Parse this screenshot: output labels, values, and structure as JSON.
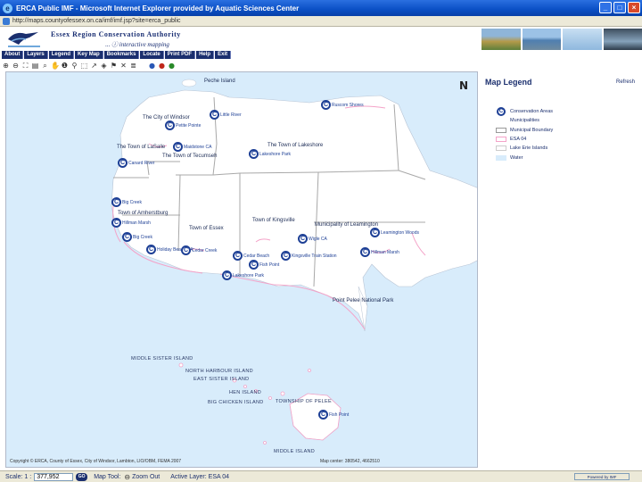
{
  "window": {
    "title": "ERCA Public IMF - Microsoft Internet Explorer provided by Aquatic Sciences Center",
    "minimize": "_",
    "maximize": "□",
    "close": "×",
    "address": "http://maps.countyofessex.on.ca/imf/imf.jsp?site=erca_public"
  },
  "header": {
    "org_name": "Essex Region Conservation Authority",
    "tagline_prefix": "...",
    "tagline": "interactive mapping"
  },
  "menu": [
    "About",
    "Layers",
    "Legend",
    "Key Map",
    "Bookmarks",
    "Locate",
    "Print PDF",
    "Help",
    "Exit"
  ],
  "toolbar": {
    "tools": [
      {
        "icon": "zoom-in-icon",
        "glyph": "⊕"
      },
      {
        "icon": "zoom-out-icon",
        "glyph": "⊖"
      },
      {
        "icon": "full-extent-icon",
        "glyph": "⛶"
      },
      {
        "icon": "print-icon",
        "glyph": "▤"
      },
      {
        "icon": "magnify-icon",
        "glyph": "⌕"
      },
      {
        "icon": "pan-icon",
        "glyph": "✋"
      },
      {
        "icon": "identify-icon",
        "glyph": "❶"
      },
      {
        "icon": "hyperlink-icon",
        "glyph": "⚲"
      },
      {
        "icon": "select-icon",
        "glyph": "⬚"
      },
      {
        "icon": "measure-icon",
        "glyph": "↗"
      },
      {
        "icon": "buffer-icon",
        "glyph": "◈"
      },
      {
        "icon": "query-icon",
        "glyph": "⚑"
      },
      {
        "icon": "clear-icon",
        "glyph": "✕"
      },
      {
        "icon": "layer-icon",
        "glyph": "≣"
      },
      {
        "icon": "blue-ball-icon",
        "glyph": "●"
      },
      {
        "icon": "red-ball-icon",
        "glyph": "●"
      },
      {
        "icon": "green-ball-icon",
        "glyph": "●"
      }
    ]
  },
  "colors": {
    "water": "#d8ecfb",
    "land": "#ffffff",
    "boundary": "#a8a8a8",
    "esa": "#f4a3c8",
    "brand": "#1b2f6e",
    "marker": "#1d3f95"
  },
  "map": {
    "north_arrow": "N",
    "labels": {
      "pelee_island_top": "Peche Island",
      "windsor": "The City of Windsor",
      "lasalle": "The Town of LaSalle",
      "tecumseh": "The Town of Tecumseh",
      "lakeshore": "The Town of Lakeshore",
      "amherstburg": "Town of Amherstburg",
      "essex": "Town of Essex",
      "kingsville": "Town of Kingsville",
      "leamington": "Municipality of Leamington",
      "point_pelee": "Point Pelee National Park",
      "middle_sister": "MIDDLE SISTER ISLAND",
      "north_harbour": "NORTH HARBOUR ISLAND",
      "east_sister": "EAST SISTER ISLAND",
      "hen_island": "HEN ISLAND",
      "big_chicken": "BIG CHICKEN ISLAND",
      "pelee_township": "TOWNSHIP OF PELEE",
      "middle_island": "MIDDLE ISLAND"
    },
    "conservation_areas": [
      "Little River",
      "Petite Pointe",
      "Maidstone CA",
      "Holiday Beach",
      "Ojibway",
      "Canard River",
      "Big Creek",
      "Hillman Marsh",
      "Ruscom Shores",
      "Cedar Creek",
      "Kingsville Train Station",
      "Cedar Beach",
      "Wigle CA",
      "Lakeshore Park",
      "Leamington Woods",
      "Fish Point",
      "Holiday Beach CA"
    ],
    "copyright": "Copyright © ERCA, County of Essex, City of Windsor, Lambton, LIO/OBM, FEMA 2007",
    "coords": "Map center: 380542, 4662510"
  },
  "legend": {
    "title": "Map Legend",
    "link": "Refresh",
    "items": [
      {
        "label": "Conservation Areas",
        "type": "icon"
      },
      {
        "label": "Municipalities",
        "type": "none"
      },
      {
        "label": "Municipal Boundary",
        "type": "outline"
      },
      {
        "label": "ESA 04",
        "type": "pink"
      },
      {
        "label": "Lake Erie Islands",
        "type": "outline-light"
      },
      {
        "label": "Water",
        "type": "water"
      }
    ]
  },
  "status": {
    "scale_label": "Scale: 1 :",
    "scale_value": "377,952",
    "go": "GO",
    "map_tool": "Map Tool:",
    "zoom_out": "Zoom Out",
    "active_layer": "Active Layer:  ESA 04",
    "powered_by": "Powered by IMF"
  }
}
